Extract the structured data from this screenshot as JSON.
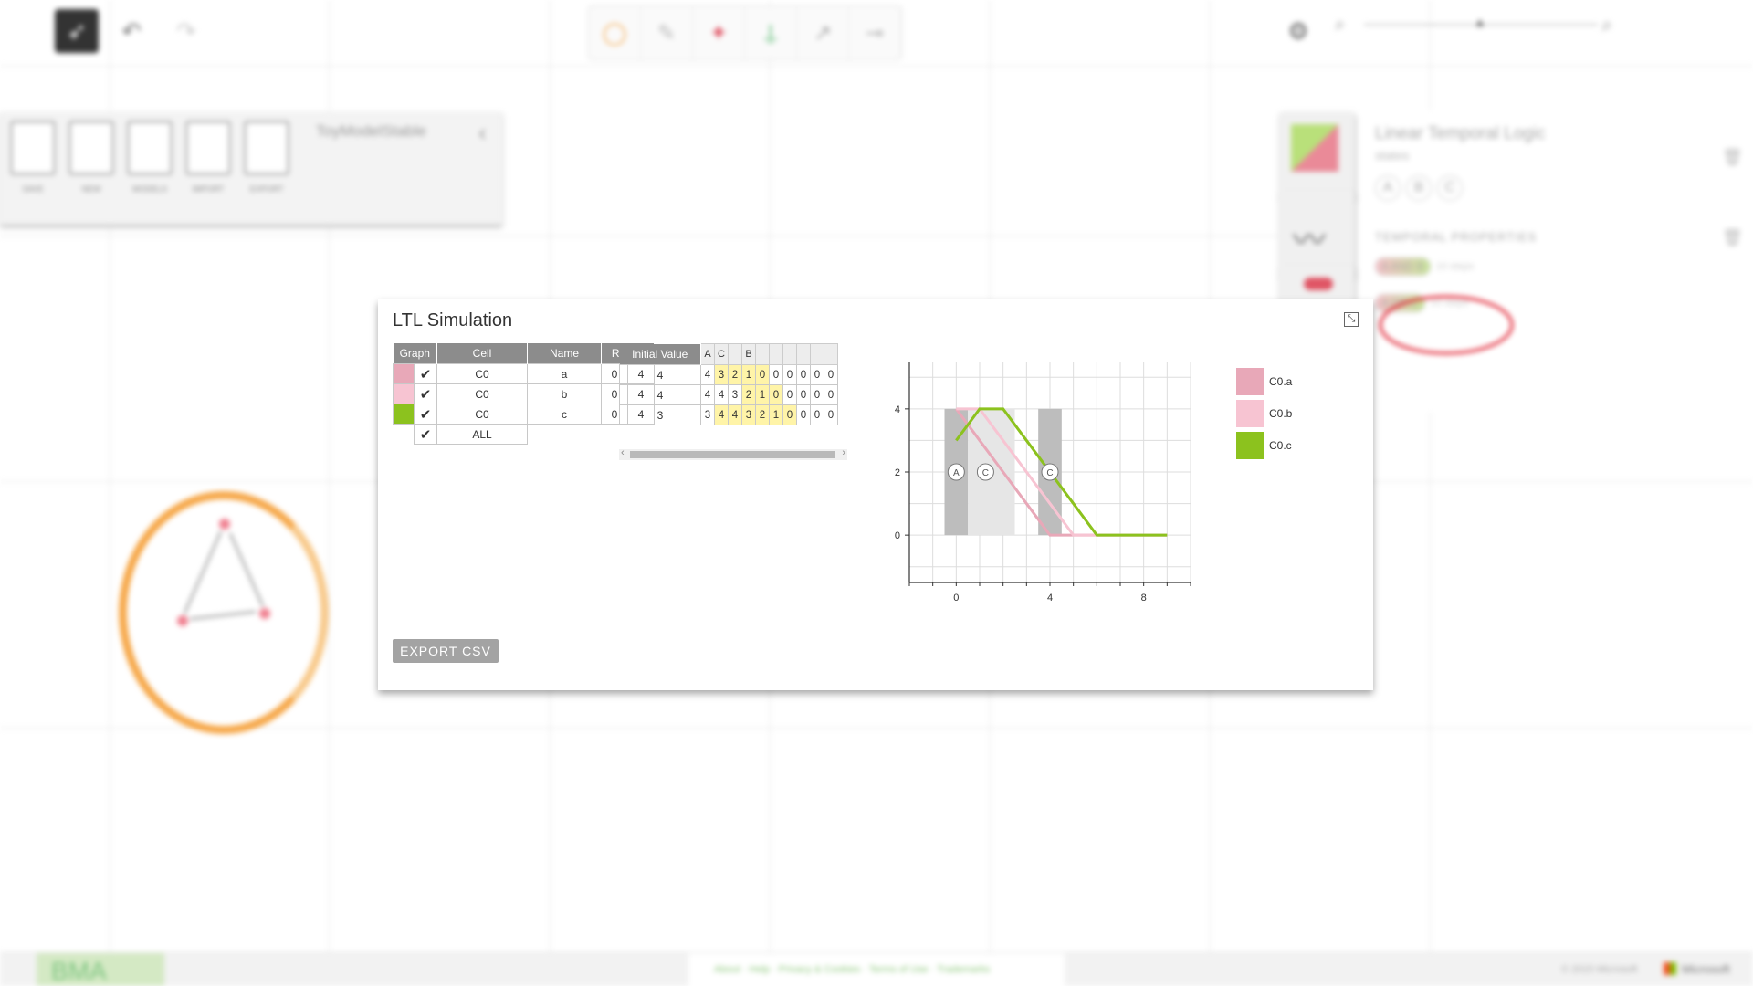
{
  "app": {
    "panel_title": "ToyModelStable",
    "file_buttons": [
      "SAVE",
      "NEW",
      "MODELS",
      "IMPORT",
      "EXPORT"
    ],
    "right_panel": {
      "title": "Linear Temporal Logic",
      "subtitle": "states",
      "state_chips": [
        "A",
        "B",
        "C"
      ],
      "section": "TEMPORAL PROPERTIES",
      "properties": [
        {
          "left": "A",
          "op": "AND",
          "right": "B",
          "steps": "10 steps"
        },
        {
          "left": "A",
          "op": "OR",
          "right": "C",
          "steps": "10 steps"
        }
      ]
    },
    "footer": {
      "brand": "BMA",
      "links": "About · Help · Privacy & Cookies · Terms of Use · Trademarks",
      "copyright": "© 2015 Microsoft",
      "company": "Microsoft"
    }
  },
  "dialog": {
    "title": "LTL Simulation",
    "export_label": "EXPORT CSV",
    "table": {
      "headers": [
        "Graph",
        "Cell",
        "Name",
        "Range"
      ],
      "rows": [
        {
          "color": "#e8a8b8",
          "checked": "✔",
          "cell": "C0",
          "name": "a",
          "min": "0",
          "max": "4"
        },
        {
          "color": "#f7c4d2",
          "checked": "✔",
          "cell": "C0",
          "name": "b",
          "min": "0",
          "max": "4"
        },
        {
          "color": "#8cc21e",
          "checked": "✔",
          "cell": "C0",
          "name": "c",
          "min": "0",
          "max": "4"
        }
      ],
      "all_label": "ALL",
      "all_checked": "✔"
    },
    "initial": {
      "header": "Initial Value",
      "state_headers": [
        "A",
        "C",
        "",
        "B",
        "",
        "",
        "",
        "",
        ""
      ],
      "rows": [
        {
          "init": "4",
          "values": [
            "4",
            "3",
            "2",
            "1",
            "0",
            "0",
            "0",
            "0",
            "0",
            "0"
          ],
          "hl": [
            1,
            2,
            3,
            4
          ]
        },
        {
          "init": "4",
          "values": [
            "4",
            "4",
            "3",
            "2",
            "1",
            "0",
            "0",
            "0",
            "0",
            "0"
          ],
          "hl": [
            3,
            4,
            5
          ]
        },
        {
          "init": "3",
          "values": [
            "3",
            "4",
            "4",
            "3",
            "2",
            "1",
            "0",
            "0",
            "0",
            "0"
          ],
          "hl": [
            1,
            2,
            3,
            4,
            5,
            6
          ]
        }
      ]
    },
    "legend": [
      {
        "label": "C0.a",
        "color": "#e8a8b8"
      },
      {
        "label": "C0.b",
        "color": "#f7c4d2"
      },
      {
        "label": "C0.c",
        "color": "#8cc21e"
      }
    ]
  },
  "chart_data": {
    "type": "line",
    "xlim": [
      -2,
      10
    ],
    "ylim": [
      -1.5,
      5.5
    ],
    "x_ticks": [
      0,
      4,
      8
    ],
    "y_ticks": [
      0,
      2,
      4
    ],
    "series": [
      {
        "name": "C0.a",
        "color": "#e8a8b8",
        "x": [
          0,
          1,
          2,
          3,
          4,
          5,
          6,
          7,
          8,
          9
        ],
        "y": [
          4,
          3,
          2,
          1,
          0,
          0,
          0,
          0,
          0,
          0
        ]
      },
      {
        "name": "C0.b",
        "color": "#f7c4d2",
        "x": [
          0,
          1,
          2,
          3,
          4,
          5,
          6,
          7,
          8,
          9
        ],
        "y": [
          4,
          4,
          3,
          2,
          1,
          0,
          0,
          0,
          0,
          0
        ]
      },
      {
        "name": "C0.c",
        "color": "#8cc21e",
        "x": [
          0,
          1,
          2,
          3,
          4,
          5,
          6,
          7,
          8,
          9
        ],
        "y": [
          3,
          4,
          4,
          3,
          2,
          1,
          0,
          0,
          0,
          0
        ]
      }
    ],
    "state_bands": [
      {
        "label": "A",
        "x0": -0.5,
        "x1": 0.5,
        "y0": 0,
        "y1": 4,
        "color": "#bdbdbd"
      },
      {
        "label": "C",
        "x0": 0.5,
        "x1": 2.5,
        "y0": 0,
        "y1": 4,
        "color": "#e6e6e6"
      },
      {
        "label": "C",
        "x0": 3.5,
        "x1": 4.5,
        "y0": 0,
        "y1": 4,
        "color": "#bdbdbd"
      }
    ]
  }
}
